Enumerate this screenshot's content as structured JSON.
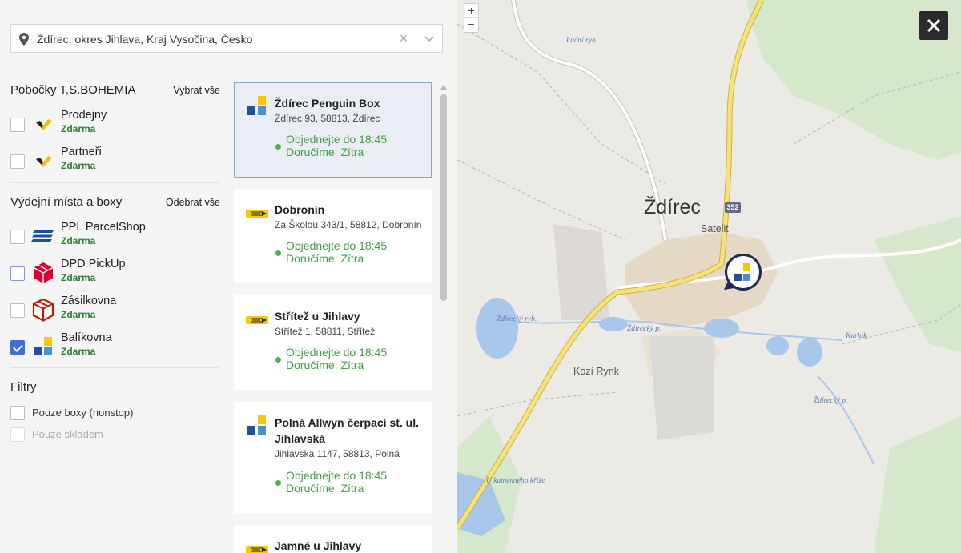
{
  "search": {
    "value": "Ždírec, okres Jihlava, Kraj Vysočina, Česko",
    "placeholder": "",
    "clear_glyph": "×"
  },
  "branches": {
    "title": "Pobočky T.S.BOHEMIA",
    "action": "Vybrat vše",
    "items": [
      {
        "name": "Prodejny",
        "price": "Zdarma",
        "checked": false,
        "icon": "tsbohemia-heart-icon"
      },
      {
        "name": "Partneři",
        "price": "Zdarma",
        "checked": false,
        "icon": "tsbohemia-heart-icon"
      }
    ]
  },
  "pickup": {
    "title": "Výdejní místa a boxy",
    "action": "Odebrat vše",
    "items": [
      {
        "name": "PPL ParcelShop",
        "price": "Zdarma",
        "checked": false,
        "icon": "ppl-icon"
      },
      {
        "name": "DPD PickUp",
        "price": "Zdarma",
        "checked": false,
        "icon": "dpd-icon"
      },
      {
        "name": "Zásilkovna",
        "price": "Zdarma",
        "checked": false,
        "icon": "zasilkovna-icon"
      },
      {
        "name": "Balíkovna",
        "price": "Zdarma",
        "checked": true,
        "icon": "balikovna-icon"
      }
    ]
  },
  "filters": {
    "title": "Filtry",
    "items": [
      {
        "label": "Pouze boxy (nonstop)",
        "enabled": true,
        "checked": false
      },
      {
        "label": "Pouze skladem",
        "enabled": false,
        "checked": false
      }
    ]
  },
  "places": [
    {
      "title": "Ždírec Penguin Box",
      "address": "Ždírec 93, 58813, Ždírec",
      "order": "Objednejte do 18:45",
      "delivery": "Doručíme: Zítra",
      "icon": "balikovna-icon",
      "selected": true
    },
    {
      "title": "Dobronín",
      "address": "Za Školou 343/1, 58812, Dobronín",
      "order": "Objednejte do 18:45",
      "delivery": "Doručíme: Zítra",
      "icon": "posta-icon",
      "selected": false
    },
    {
      "title": "Střítež u Jihlavy",
      "address": "Střítež 1, 58811, Střítež",
      "order": "Objednejte do 18:45",
      "delivery": "Doručíme: Zítra",
      "icon": "posta-icon",
      "selected": false
    },
    {
      "title": "Polná Allwyn čerpací st. ul. Jihlavská",
      "address": "Jihlavská 1147, 58813, Polná",
      "order": "Objednejte do 18:45",
      "delivery": "Doručíme: Zítra",
      "icon": "balikovna-icon",
      "selected": false
    },
    {
      "title": "Jamné u Jihlavy",
      "address": "",
      "order": "",
      "delivery": "",
      "icon": "posta-icon",
      "selected": false
    }
  ],
  "map": {
    "town": "Ždírec",
    "labels": [
      "Luční ryb.",
      "Satelit",
      "Ždírecký ryb.",
      "Ždírecký p.",
      "Karlák",
      "Kozí Rynk",
      "Ždírecký p.",
      "U kamenného kříže"
    ],
    "road_number": "352",
    "zoom_in": "+",
    "zoom_out": "−"
  },
  "colors": {
    "accent_blue": "#3d6fd8",
    "price_green": "#2e7d32",
    "order_green": "#43a047",
    "balikovna_yellow": "#f5c800",
    "balikovna_blue": "#1f4fa3",
    "dpd_red": "#dc0032"
  }
}
